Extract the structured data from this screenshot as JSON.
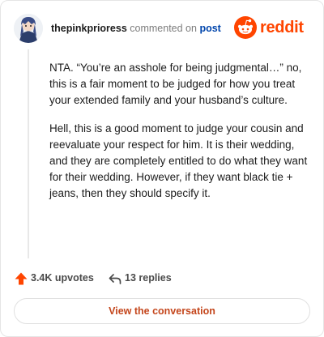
{
  "header": {
    "username": "thepinkprioress",
    "connector": "commented on",
    "post_link": "post",
    "brand": "reddit"
  },
  "comment": {
    "paragraphs": [
      "NTA. “You’re an asshole for being judgmental…” no, this is a fair moment to be judged for how you treat your extended family and your husband’s culture.",
      "Hell, this is a good moment to judge your cousin and reevaluate your respect for him. It is their wedding, and they are completely entitled to do what they want for their wedding. However, if they want black tie + jeans, then they should specify it."
    ]
  },
  "actions": {
    "upvotes": "3.4K upvotes",
    "replies": "13 replies"
  },
  "cta_label": "View the conversation",
  "colors": {
    "brand": "#ff4500",
    "link": "#0045ac",
    "cta_text": "#c4461c"
  },
  "icons": {
    "avatar": "user-avatar",
    "brand": "reddit-logo-icon",
    "upvote": "upvote-arrow-icon",
    "reply": "reply-arrow-icon"
  }
}
